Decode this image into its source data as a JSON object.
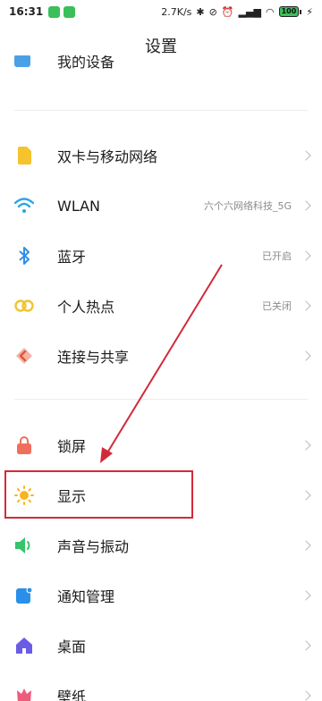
{
  "status_bar": {
    "time": "16:31",
    "speed": "2.7K/s",
    "battery": "100"
  },
  "page": {
    "title": "设置"
  },
  "partial_item": {
    "label": "我的设备",
    "icon": "device-icon"
  },
  "items": [
    {
      "key": "dual-sim",
      "label": "双卡与移动网络",
      "value": "",
      "icon": "sim-card-icon",
      "color": "#f5c32c"
    },
    {
      "key": "wlan",
      "label": "WLAN",
      "value": "六个六网络科技_5G",
      "icon": "wifi-icon",
      "color": "#2fa4e7"
    },
    {
      "key": "bluetooth",
      "label": "蓝牙",
      "value": "已开启",
      "icon": "bluetooth-icon",
      "color": "#2f8fe8"
    },
    {
      "key": "hotspot",
      "label": "个人热点",
      "value": "已关闭",
      "icon": "hotspot-icon",
      "color": "#f0c52e"
    },
    {
      "key": "connect-share",
      "label": "连接与共享",
      "value": "",
      "icon": "connect-share-icon",
      "color": "#e56a4a"
    },
    {
      "key": "lock-screen",
      "label": "锁屏",
      "value": "",
      "icon": "lock-icon",
      "color": "#ef6f5c"
    },
    {
      "key": "display",
      "label": "显示",
      "value": "",
      "icon": "sun-icon",
      "color": "#f6b51e"
    },
    {
      "key": "sound",
      "label": "声音与振动",
      "value": "",
      "icon": "speaker-icon",
      "color": "#36c46b"
    },
    {
      "key": "notifications",
      "label": "通知管理",
      "value": "",
      "icon": "notification-icon",
      "color": "#2a8fe8"
    },
    {
      "key": "desktop",
      "label": "桌面",
      "value": "",
      "icon": "home-icon",
      "color": "#6a5ce6"
    },
    {
      "key": "wallpaper",
      "label": "壁纸",
      "value": "",
      "icon": "wallpaper-icon",
      "color": "#ef5b7a"
    }
  ]
}
